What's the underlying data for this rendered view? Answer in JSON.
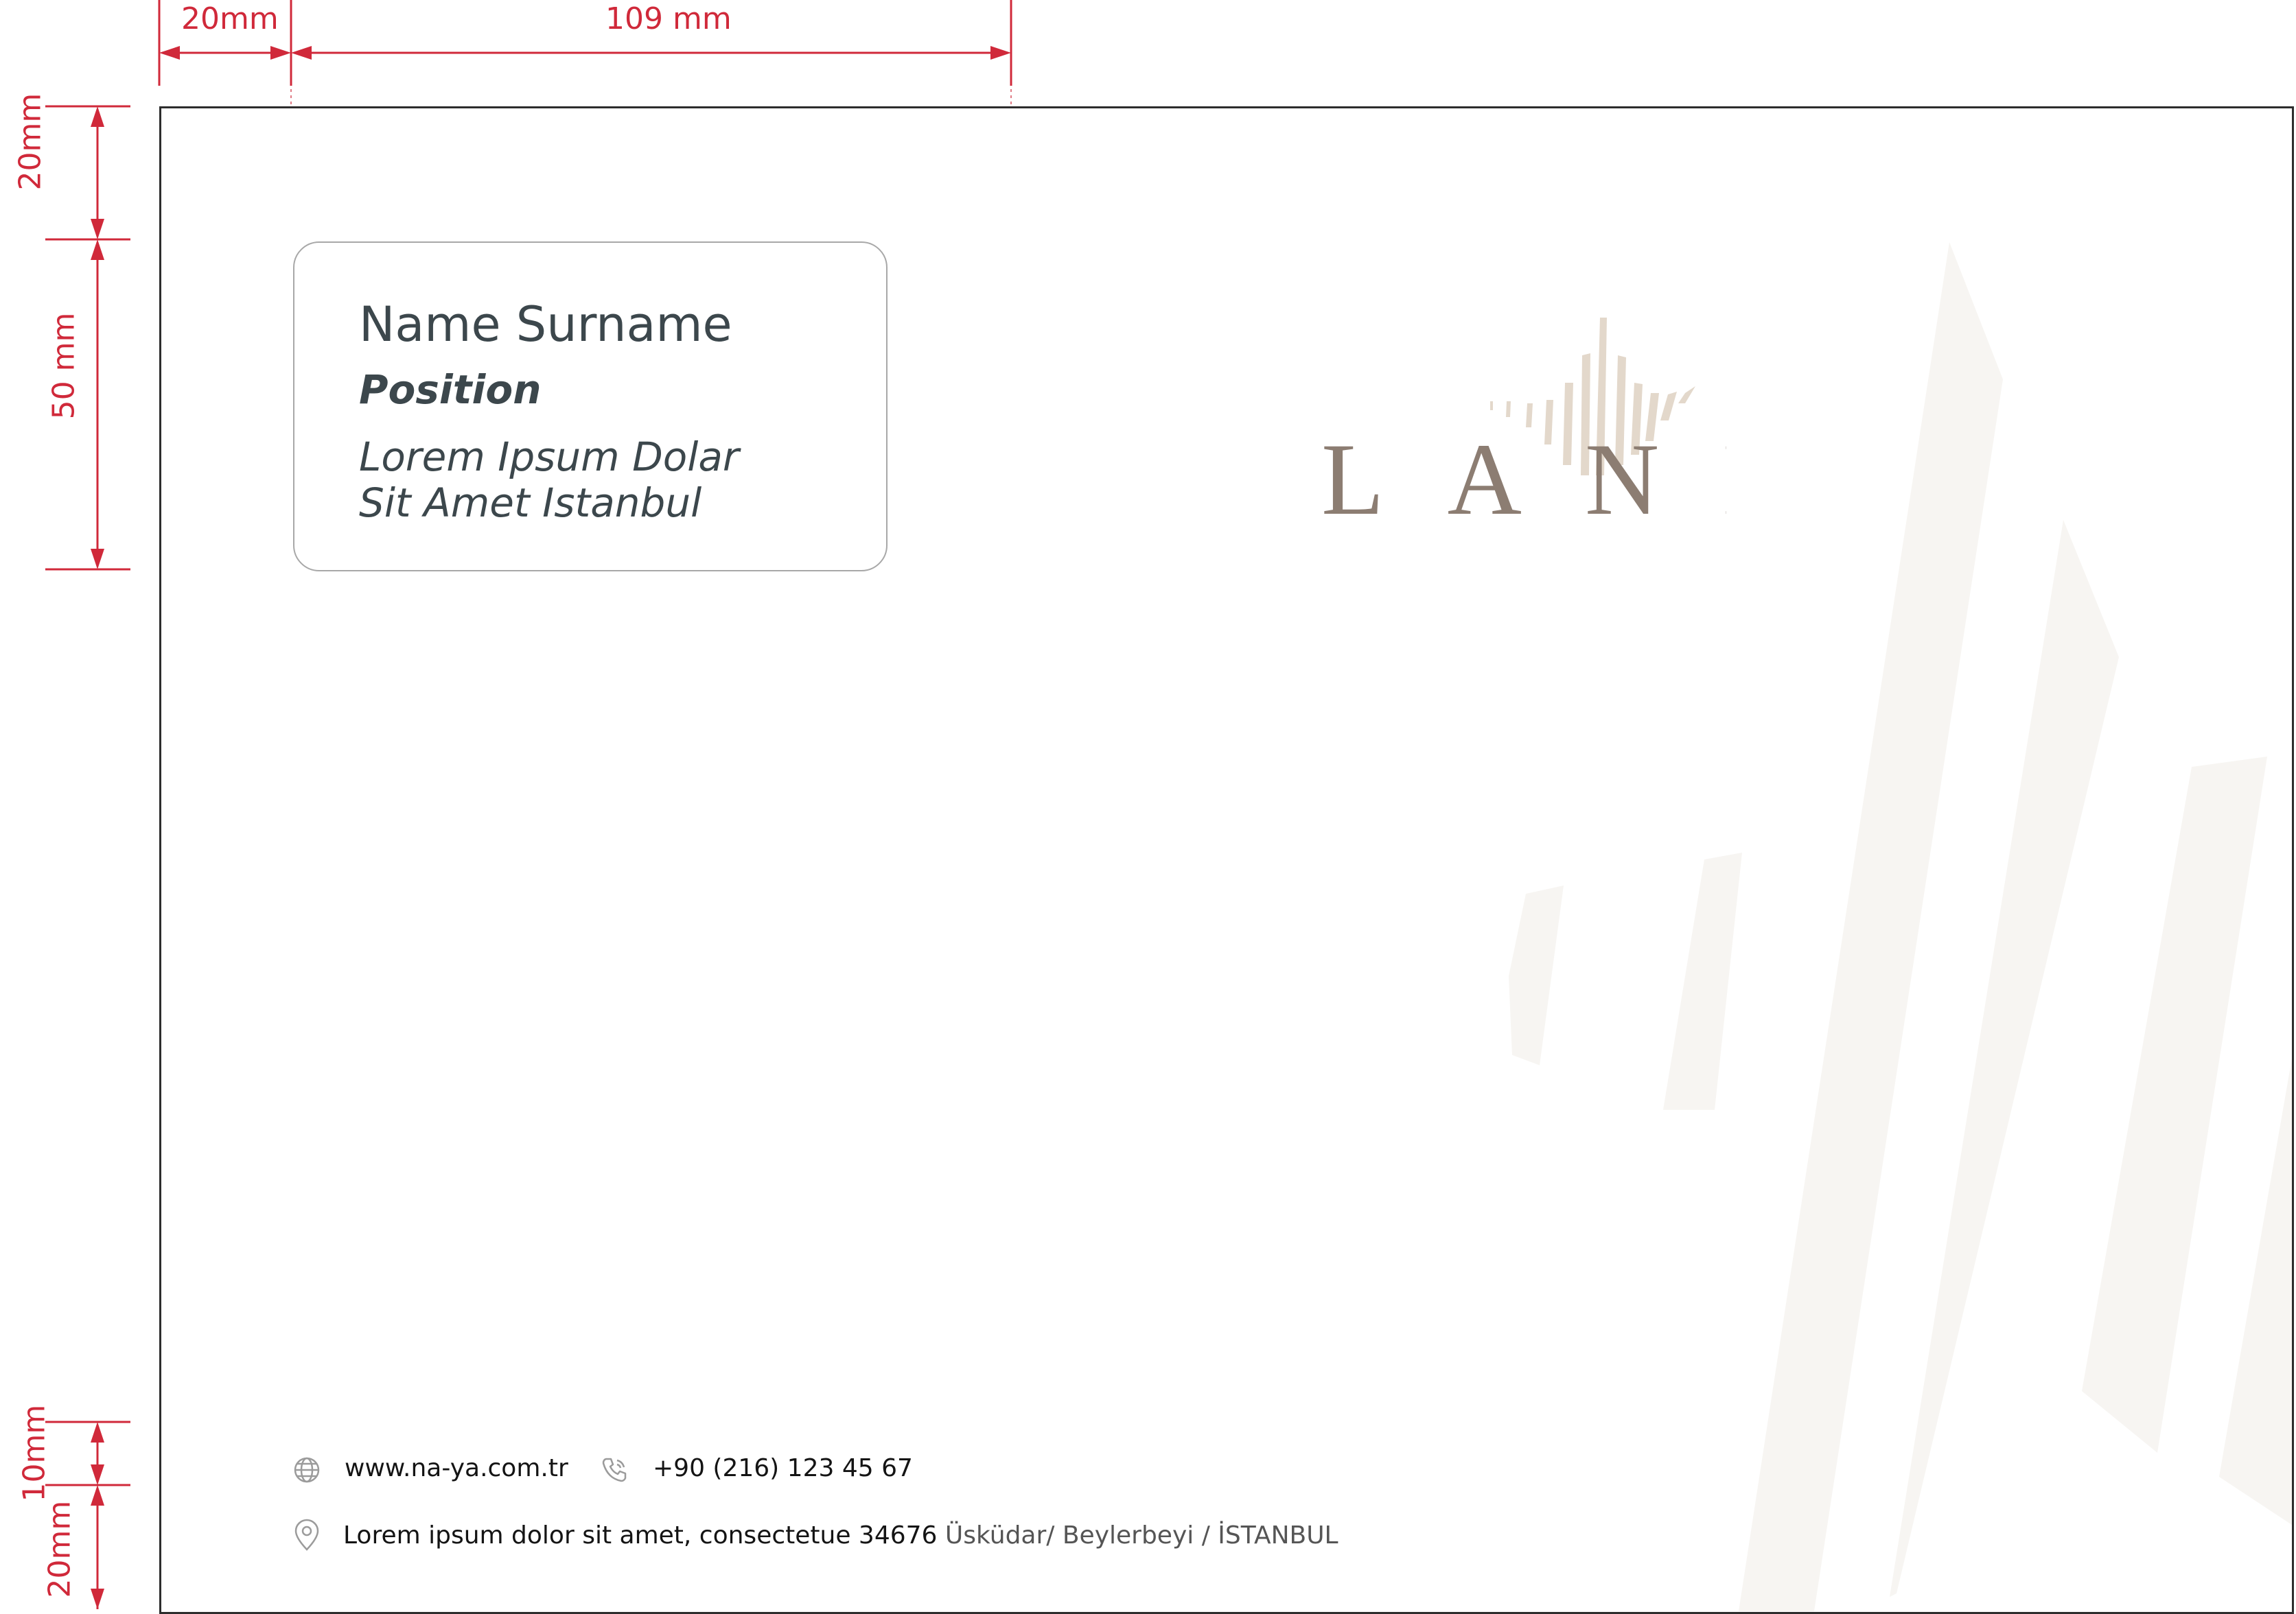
{
  "dimensions": {
    "left_margin": "20mm",
    "window_width": "109 mm",
    "top_margin": "20mm",
    "window_height": "50 mm",
    "footer_gap": "10mm",
    "bottom_margin": "20mm"
  },
  "address_window": {
    "name": "Name Surname",
    "position": "Position",
    "address_line_1": "Lorem Ipsum Dolar",
    "address_line_2": "Sit Amet Istanbul"
  },
  "logo": {
    "text": "LANI",
    "colors": {
      "text": "#8c7d72",
      "star": "#e3d8cb"
    }
  },
  "footer": {
    "website": "www.na-ya.com.tr",
    "phone": "+90 (216) 123 45 67",
    "address_main": "Lorem ipsum dolor sit amet, consectetue 34676",
    "address_district": "Üsküdar/ Beylerbeyi / İSTANBUL"
  },
  "colors": {
    "dimension": "#d0293a",
    "text": "#3c474c",
    "decor": "#f7f5f2"
  },
  "icons": [
    "globe-icon",
    "phone-icon",
    "location-pin-icon"
  ]
}
